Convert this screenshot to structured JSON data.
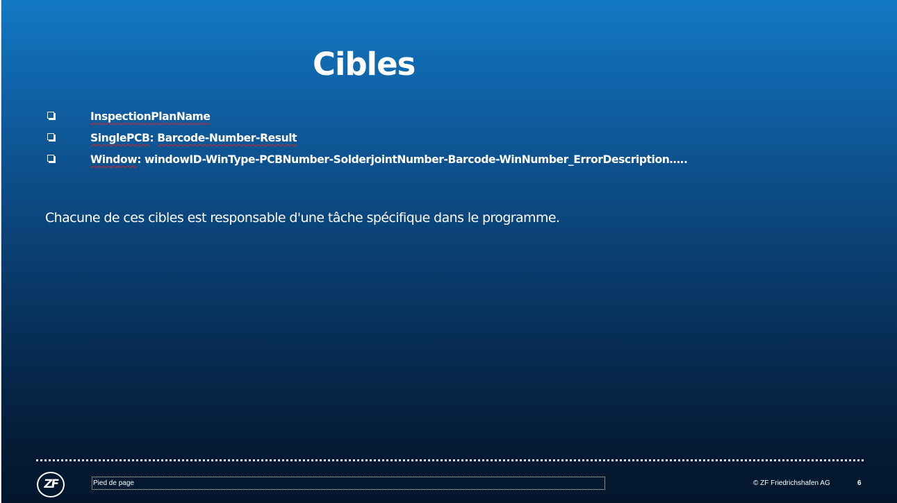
{
  "slide": {
    "title": "Cibles",
    "targets": [
      {
        "name": "InspectionPlanName",
        "separator": "",
        "value": ""
      },
      {
        "name": "SinglePCB",
        "separator": ": ",
        "value": "Barcode-Number-Result"
      },
      {
        "name": "Window",
        "separator": ": ",
        "value": "windowID-WinType-PCBNumber-SolderjointNumber-Barcode-WinNumber_ErrorDescription….."
      }
    ],
    "description": "Chacune de ces cibles est responsable d'une tâche spécifique dans le programme.",
    "bullet_icon": "checkbox-bullet-icon"
  },
  "footer": {
    "logo_text": "ZF",
    "footer_text": "Pied de page",
    "copyright": "© ZF Friedrichshafen AG",
    "page_number": "6"
  },
  "colors": {
    "background_top": "#1279c3",
    "background_bottom": "#03162c",
    "text": "#ffffff",
    "spellcheck_underline": "#e02020"
  }
}
